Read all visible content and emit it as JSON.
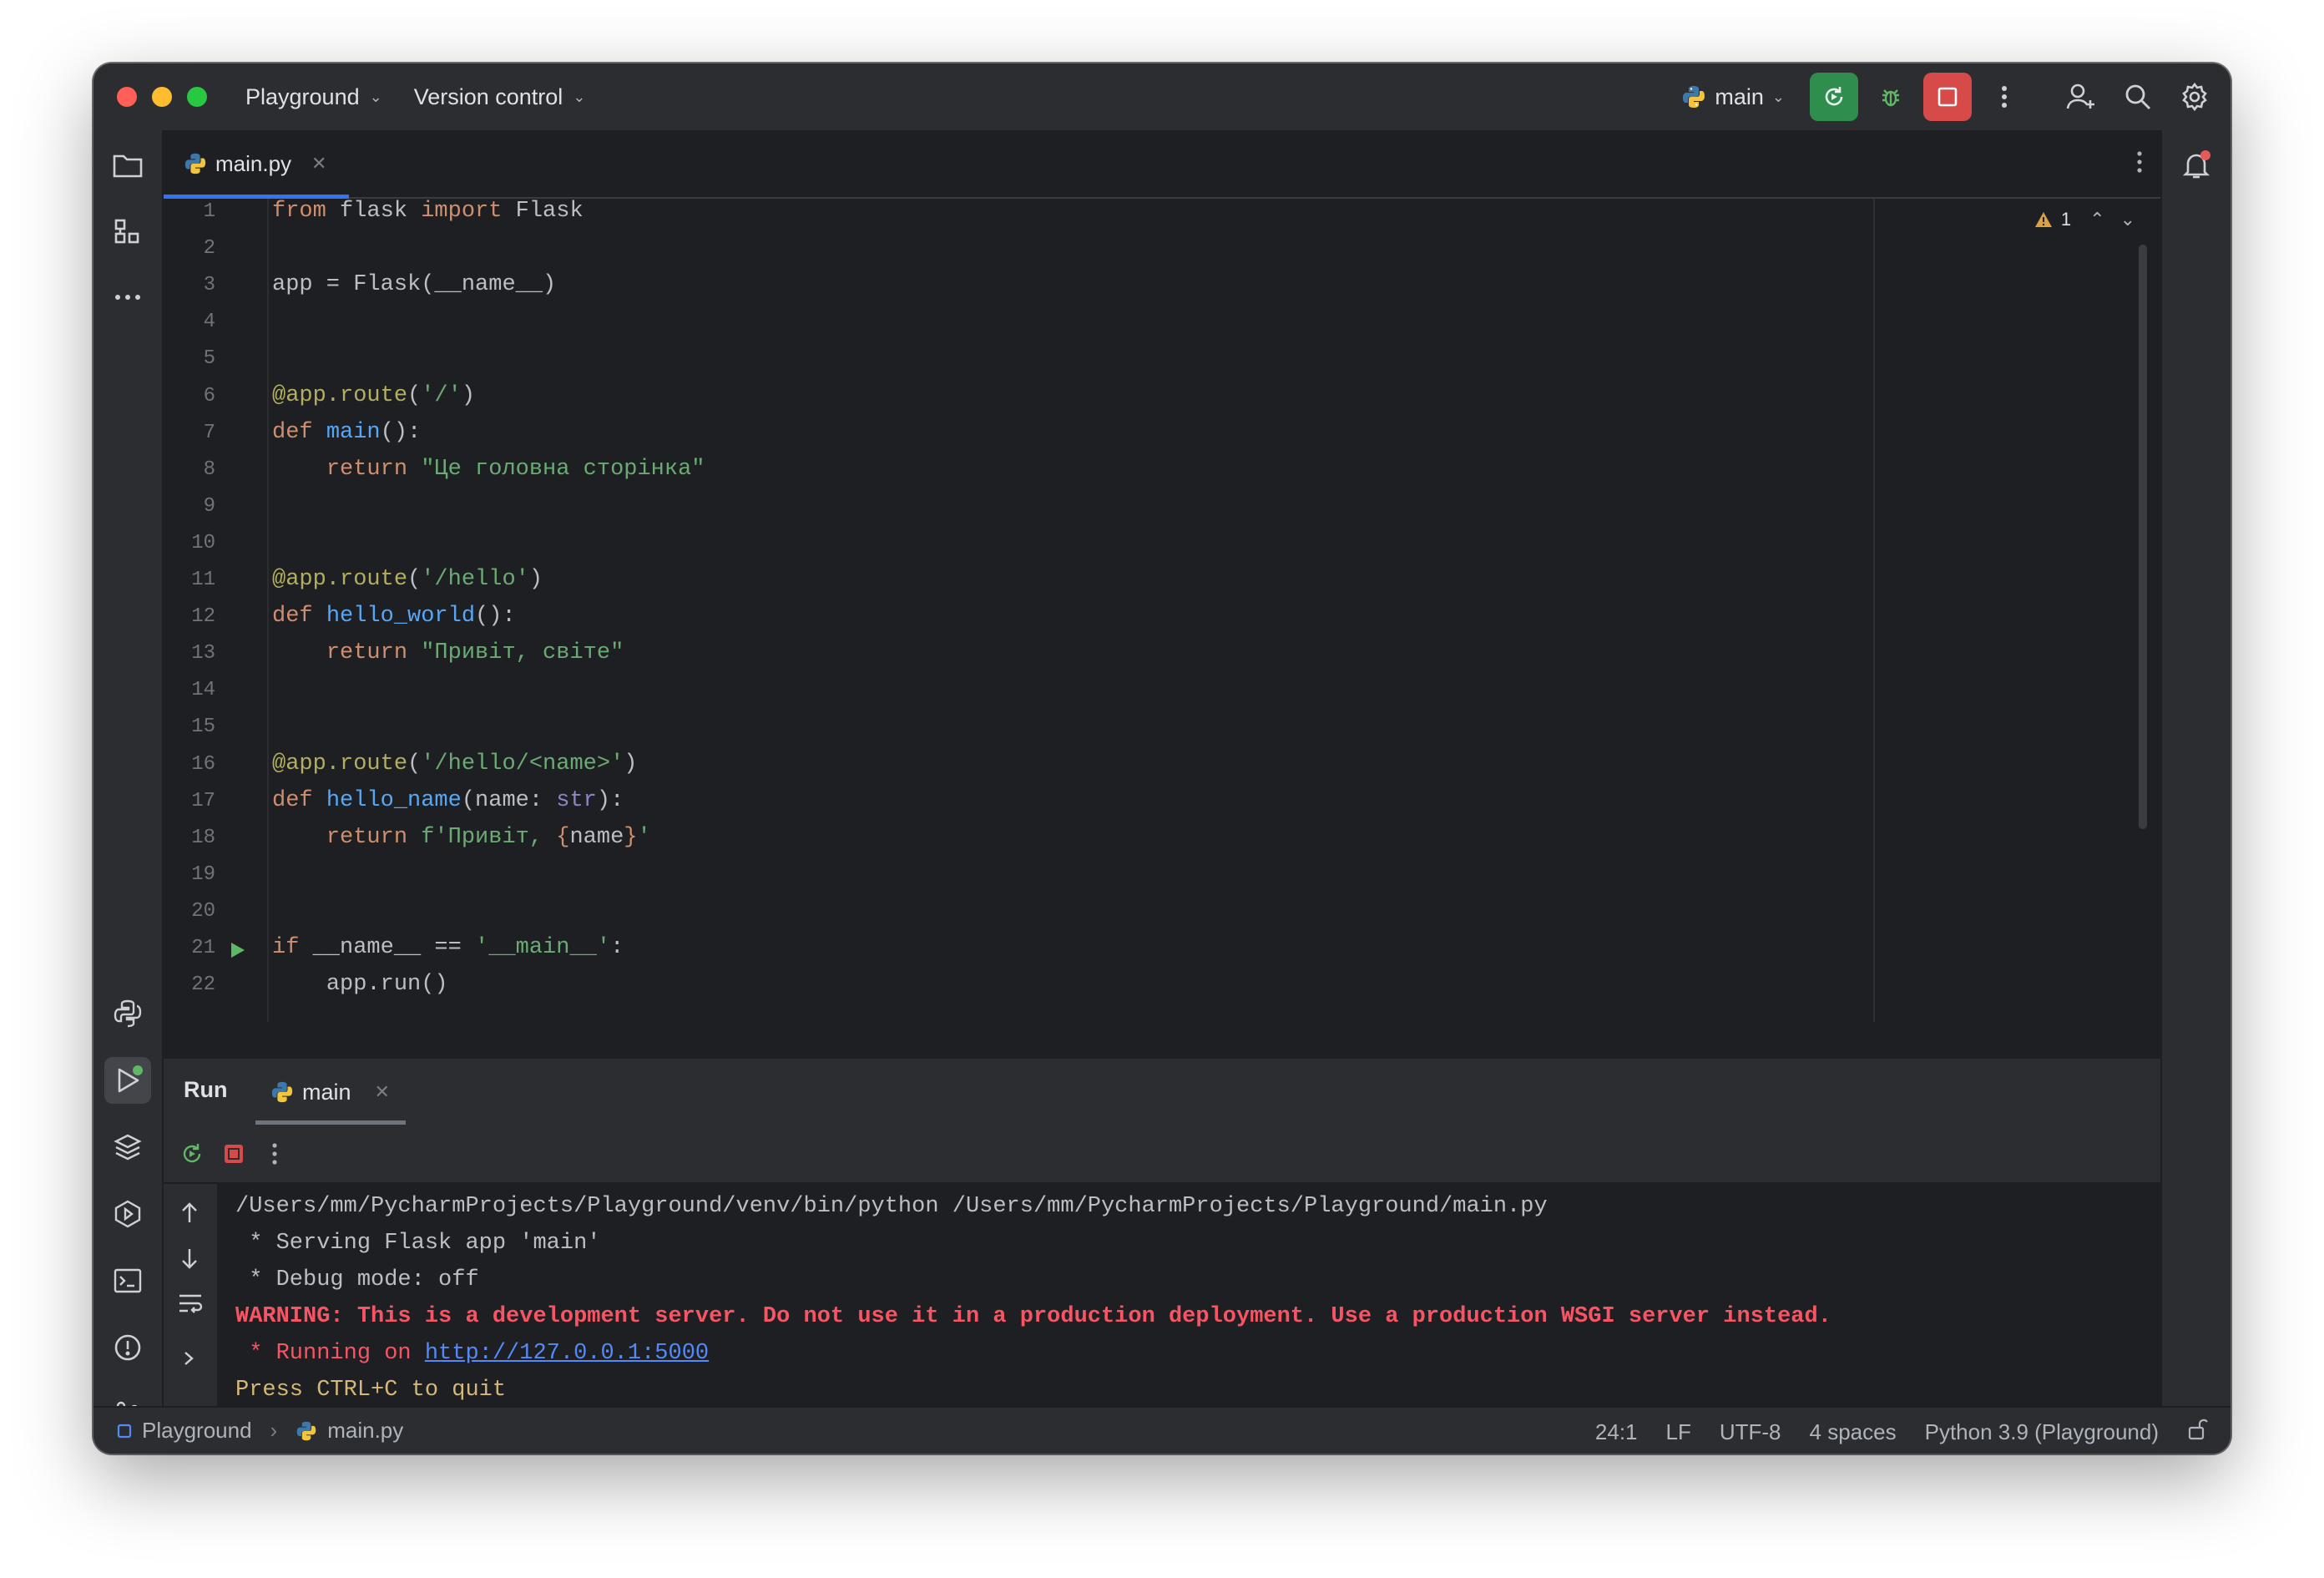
{
  "titlebar": {
    "project": "Playground",
    "vcs": "Version control",
    "run_config": "main"
  },
  "tab": {
    "file": "main.py"
  },
  "editor": {
    "inspection_count": "1",
    "lines": [
      {
        "n": "1"
      },
      {
        "n": "2"
      },
      {
        "n": "3"
      },
      {
        "n": "4"
      },
      {
        "n": "5"
      },
      {
        "n": "6"
      },
      {
        "n": "7"
      },
      {
        "n": "8"
      },
      {
        "n": "9"
      },
      {
        "n": "10"
      },
      {
        "n": "11"
      },
      {
        "n": "12"
      },
      {
        "n": "13"
      },
      {
        "n": "14"
      },
      {
        "n": "15"
      },
      {
        "n": "16"
      },
      {
        "n": "17"
      },
      {
        "n": "18"
      },
      {
        "n": "19"
      },
      {
        "n": "20"
      },
      {
        "n": "21"
      },
      {
        "n": "22"
      }
    ],
    "code": {
      "l1": {
        "a": "from",
        "b": " flask ",
        "c": "import",
        "d": " Flask"
      },
      "l3": "app = Flask(__name__)",
      "l6": {
        "dec": "@app.route",
        "p1": "(",
        "s": "'/'",
        "p2": ")"
      },
      "l7": {
        "kw": "def",
        "fn": "main",
        "rest": "():"
      },
      "l8": {
        "kw": "return",
        "s": "\"Це головна сторінка\""
      },
      "l11": {
        "dec": "@app.route",
        "p1": "(",
        "s": "'/hello'",
        "p2": ")"
      },
      "l12": {
        "kw": "def",
        "fn": "hello_world",
        "rest": "():"
      },
      "l13": {
        "kw": "return",
        "s": "\"Привіт, світе\""
      },
      "l16": {
        "dec": "@app.route",
        "p1": "(",
        "s": "'/hello/<name>'",
        "p2": ")"
      },
      "l17": {
        "kw": "def",
        "fn": "hello_name",
        "rest1": "(name: ",
        "blt": "str",
        "rest2": "):"
      },
      "l18": {
        "kw": "return",
        "s1": "f'Привіт, ",
        "b1": "{",
        "v": "name",
        "b2": "}",
        "s2": "'"
      },
      "l21": {
        "kw": "if",
        "mid": " __name__ == ",
        "s": "'__main__'",
        "end": ":"
      },
      "l22": "app.run()"
    }
  },
  "run": {
    "title": "Run",
    "tab": "main",
    "console": {
      "cmd": "/Users/mm/PycharmProjects/Playground/venv/bin/python /Users/mm/PycharmProjects/Playground/main.py",
      "serving": " * Serving Flask app 'main'",
      "debug": " * Debug mode: off",
      "warning": "WARNING: This is a development server. Do not use it in a production deployment. Use a production WSGI server instead.",
      "running_prefix": " * Running on ",
      "url": "http://127.0.0.1:5000",
      "quit": "Press CTRL+C to quit"
    }
  },
  "statusbar": {
    "project": "Playground",
    "file": "main.py",
    "position": "24:1",
    "line_sep": "LF",
    "encoding": "UTF-8",
    "indent": "4 spaces",
    "interpreter": "Python 3.9 (Playground)"
  },
  "colors": {
    "accent": "#3574f0",
    "run_button": "#2f8d4e",
    "stop_button": "#d64a4a",
    "warning_text": "#f75464"
  }
}
